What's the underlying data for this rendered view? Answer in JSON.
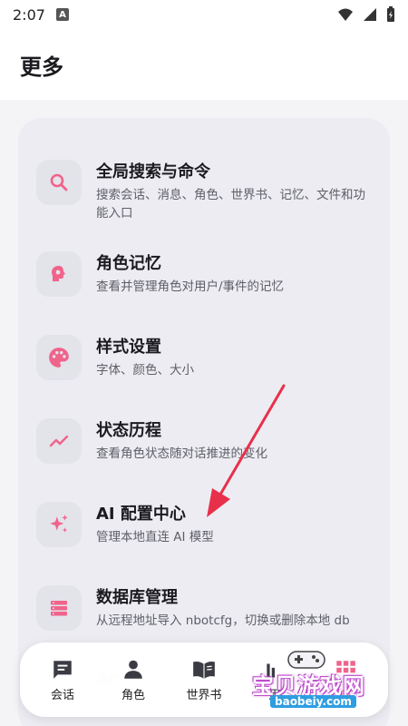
{
  "status": {
    "time": "2:07",
    "badge": "A"
  },
  "header": {
    "title": "更多"
  },
  "items": [
    {
      "title": "全局搜索与命令",
      "desc": "搜索会话、消息、角色、世界书、记忆、文件和功能入口",
      "icon": "search-icon"
    },
    {
      "title": "角色记忆",
      "desc": "查看并管理角色对用户/事件的记忆",
      "icon": "brain-icon"
    },
    {
      "title": "样式设置",
      "desc": "字体、颜色、大小",
      "icon": "palette-icon"
    },
    {
      "title": "状态历程",
      "desc": "查看角色状态随对话推进的变化",
      "icon": "trending-icon"
    },
    {
      "title": "AI 配置中心",
      "desc": "管理本地直连 AI 模型",
      "icon": "sparkle-icon"
    },
    {
      "title": "数据库管理",
      "desc": "从远程地址导入 nbotcfg，切换或删除本地 db",
      "icon": "database-icon"
    }
  ],
  "ghost_text": "Ac",
  "nav": [
    {
      "label": "会话",
      "icon": "chat-icon"
    },
    {
      "label": "角色",
      "icon": "person-icon"
    },
    {
      "label": "世界书",
      "icon": "book-icon"
    },
    {
      "label": "用",
      "icon": "user-icon"
    },
    {
      "label": "多",
      "icon": "more-icon"
    }
  ],
  "watermark": {
    "text": "宝贝游戏网",
    "url": "baobeiy.com"
  },
  "colors": {
    "accent": "#f0638a",
    "background": "#f4f4f7",
    "card": "#ececf2"
  }
}
